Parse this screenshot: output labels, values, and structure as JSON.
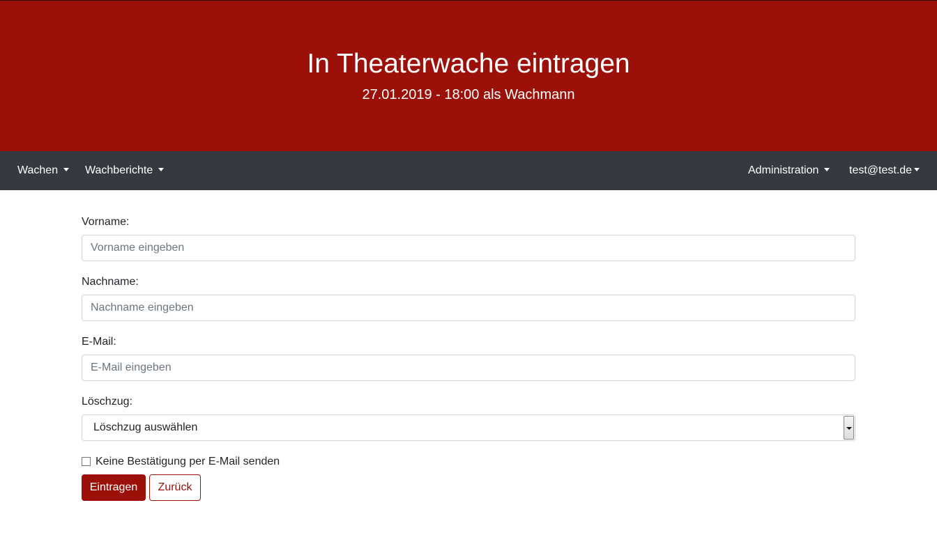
{
  "header": {
    "title": "In Theaterwache eintragen",
    "subtitle": "27.01.2019 - 18:00 als Wachmann",
    "background_color": "#9b1008"
  },
  "navbar": {
    "background_color": "#343a40",
    "left_items": [
      {
        "label": "Wachen",
        "icon": "caret-down-icon"
      },
      {
        "label": "Wachberichte",
        "icon": "caret-down-icon"
      }
    ],
    "right_items": [
      {
        "label": "Administration",
        "icon": "caret-down-icon"
      },
      {
        "label": "test@test.de",
        "icon": "caret-down-icon"
      }
    ]
  },
  "form": {
    "vorname": {
      "label": "Vorname:",
      "placeholder": "Vorname eingeben",
      "value": ""
    },
    "nachname": {
      "label": "Nachname:",
      "placeholder": "Nachname eingeben",
      "value": ""
    },
    "email": {
      "label": "E-Mail:",
      "placeholder": "E-Mail eingeben",
      "value": ""
    },
    "loeschzug": {
      "label": "Löschzug:",
      "selected": "Löschzug auswählen",
      "icon": "dropdown-arrow-icon"
    },
    "no_confirmation": {
      "label": "Keine Bestätigung per E-Mail senden",
      "checked": false
    },
    "submit_label": "Eintragen",
    "back_label": "Zurück",
    "accent_color": "#9b1008"
  }
}
